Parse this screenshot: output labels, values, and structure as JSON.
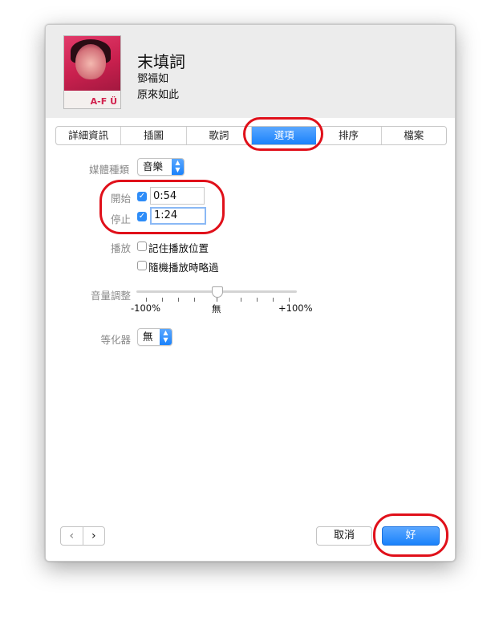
{
  "header": {
    "song_title": "末填詞",
    "artist": "鄧福如",
    "album": "原來如此",
    "album_art_logo": "A-F Ü"
  },
  "tabs": [
    {
      "label": "詳細資訊",
      "selected": false
    },
    {
      "label": "插圖",
      "selected": false
    },
    {
      "label": "歌詞",
      "selected": false
    },
    {
      "label": "選項",
      "selected": true
    },
    {
      "label": "排序",
      "selected": false
    },
    {
      "label": "檔案",
      "selected": false
    }
  ],
  "options": {
    "media_kind_label": "媒體種類",
    "media_kind_value": "音樂",
    "start_label": "開始",
    "start_checked": true,
    "start_value": "0:54",
    "stop_label": "停止",
    "stop_checked": true,
    "stop_value": "1:24",
    "playback_label": "播放",
    "remember_position_label": "記住播放位置",
    "remember_position_checked": false,
    "skip_shuffle_label": "隨機播放時略過",
    "skip_shuffle_checked": false,
    "volume_label": "音量調整",
    "volume_min_label": "-100%",
    "volume_mid_label": "無",
    "volume_max_label": "+100%",
    "volume_value_percent": 0,
    "equalizer_label": "等化器",
    "equalizer_value": "無"
  },
  "footer": {
    "prev_label": "‹",
    "next_label": "›",
    "cancel_label": "取消",
    "ok_label": "好"
  },
  "colors": {
    "accent": "#1a82fb",
    "annotation": "#e0101a"
  }
}
